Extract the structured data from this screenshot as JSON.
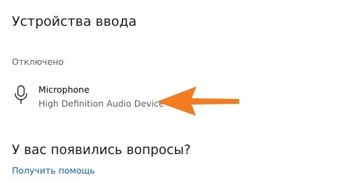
{
  "input_devices": {
    "title": "Устройства ввода",
    "group_label": "Отключено",
    "devices": [
      {
        "name": "Microphone",
        "description": "High Definition Audio Device",
        "icon": "microphone-icon"
      }
    ]
  },
  "annotation": {
    "icon": "arrow-left-icon",
    "color": "#f47c20"
  },
  "help": {
    "title": "У вас появились вопросы?",
    "link_label": "Получить помощь",
    "link_color": "#0067c0"
  }
}
